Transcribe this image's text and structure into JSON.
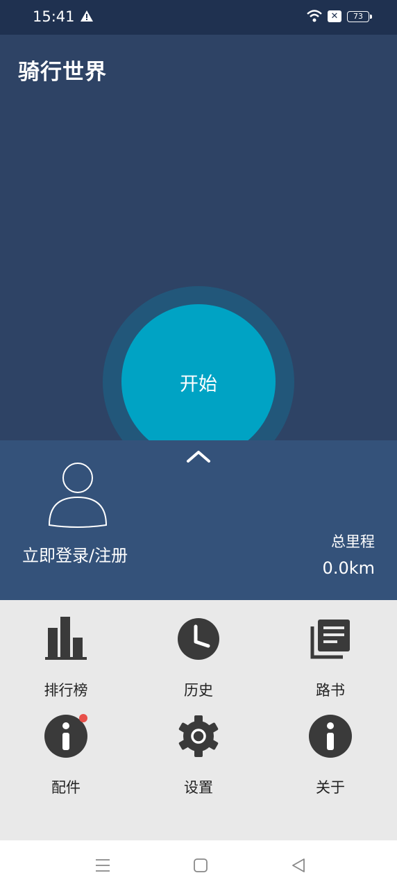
{
  "status": {
    "time": "15:41",
    "battery": "73"
  },
  "app": {
    "title": "骑行世界"
  },
  "start": {
    "label": "开始"
  },
  "profile": {
    "login_label": "立即登录/注册",
    "mileage_label": "总里程",
    "mileage_value": "0.0km"
  },
  "menu": {
    "items": [
      {
        "label": "排行榜",
        "icon": "bar-chart-icon"
      },
      {
        "label": "历史",
        "icon": "clock-icon"
      },
      {
        "label": "路书",
        "icon": "book-stack-icon"
      },
      {
        "label": "配件",
        "icon": "info-icon"
      },
      {
        "label": "设置",
        "icon": "gear-icon"
      },
      {
        "label": "关于",
        "icon": "info-icon"
      }
    ]
  },
  "colors": {
    "header": "#2e4365",
    "panel": "#34527a",
    "accent": "#00a3c4",
    "notification": "#e8504a"
  }
}
